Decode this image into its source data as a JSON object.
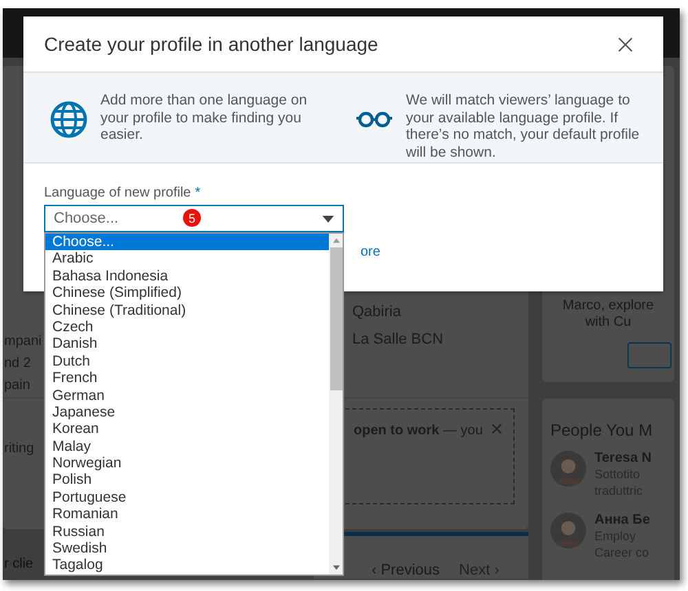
{
  "modal": {
    "title": "Create your profile in another language",
    "info": [
      {
        "kind": "globe",
        "text": "Add more than one language on your profile to make finding you easier."
      },
      {
        "kind": "glasses",
        "text": "We will match viewers’ language to your available language profile. If there’s no match, your default profile will be shown."
      }
    ],
    "field": {
      "label": "Language of new profile",
      "required_mark": "*",
      "value": "Choose...",
      "badge": "5"
    },
    "link_fragment": "ore",
    "options": [
      {
        "label": "Choose...",
        "selected": true
      },
      {
        "label": "Arabic",
        "selected": false
      },
      {
        "label": "Bahasa Indonesia",
        "selected": false
      },
      {
        "label": "Chinese (Simplified)",
        "selected": false
      },
      {
        "label": "Chinese (Traditional)",
        "selected": false
      },
      {
        "label": "Czech",
        "selected": false
      },
      {
        "label": "Danish",
        "selected": false
      },
      {
        "label": "Dutch",
        "selected": false
      },
      {
        "label": "French",
        "selected": false
      },
      {
        "label": "German",
        "selected": false
      },
      {
        "label": "Japanese",
        "selected": false
      },
      {
        "label": "Korean",
        "selected": false
      },
      {
        "label": "Malay",
        "selected": false
      },
      {
        "label": "Norwegian",
        "selected": false
      },
      {
        "label": "Polish",
        "selected": false
      },
      {
        "label": "Portuguese",
        "selected": false
      },
      {
        "label": "Romanian",
        "selected": false
      },
      {
        "label": "Russian",
        "selected": false
      },
      {
        "label": "Swedish",
        "selected": false
      },
      {
        "label": "Tagalog",
        "selected": false
      }
    ]
  },
  "background": {
    "fragments": [
      "mpani",
      "nd 2",
      "pain"
    ],
    "schools": [
      "Qabiria",
      "La Salle BCN"
    ],
    "writing": "riting",
    "open_to_work": "**open to work** — you",
    "client": "r clie",
    "pager": {
      "previous": "‹ Previous",
      "next": "Next ›"
    },
    "promo": [
      "Marco, explore",
      "with Cu"
    ],
    "people": {
      "title": "People You M",
      "persons": [
        {
          "name": "Teresa N",
          "lines": [
            "Sottotito",
            "traduttric"
          ]
        },
        {
          "name": "Анна Бе",
          "lines": [
            "Employ",
            "Career co"
          ]
        }
      ]
    }
  }
}
